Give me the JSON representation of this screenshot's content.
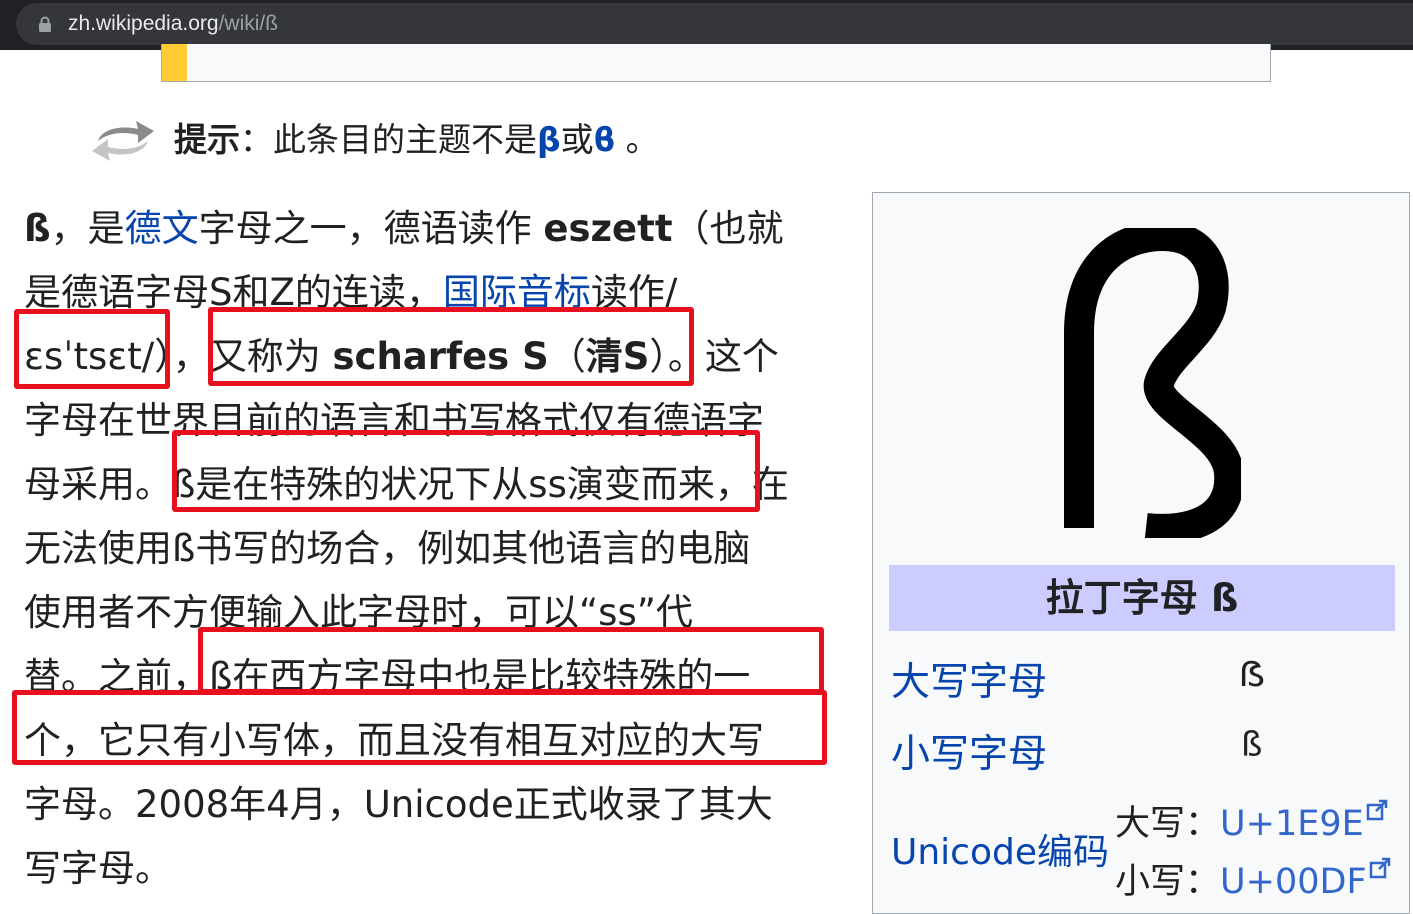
{
  "browser": {
    "url_host": "zh.wikipedia.org",
    "url_path": "/wiki/ß"
  },
  "hatnote": {
    "label": "提示",
    "colon": "：此条目的主题不是",
    "link1": "β",
    "or": "或",
    "link2": "ϐ",
    "end": " 。"
  },
  "article": {
    "l1_a": "ß",
    "l1_b": "，是",
    "l1_link": "德文",
    "l1_c": "字母之一，德语读作 ",
    "l1_bold": "eszett",
    "l1_d": "（也就",
    "l2_a": "是德语字母S和Z的连读，",
    "l2_link": "国际音标",
    "l2_b": "读作/",
    "l3_a": "ɛsˈtsɛt/）",
    "l3_b": "，",
    "l3_c": "又称为 ",
    "l3_bold": "scharfes S",
    "l3_d": "（",
    "l3_bold2": "清S",
    "l3_e": "）。这个",
    "l4": "字母在世界目前的语言和书写格式仅有德语字",
    "l5_a": "母采用。",
    "l5_b": "ß是在特殊的状况下从ss演变而来",
    "l5_c": "，在",
    "l6": "无法使用ß书写的场合，例如其他语言的电脑",
    "l7": "使用者不方便输入此字母时，可以“ss”代",
    "l8_a": "替。之前，",
    "l8_b": "ß在西方字母中也是比较特殊的一",
    "l9": "个，它只有小写体，而且没有相互对应的大写",
    "l10": "字母。2008年4月，Unicode正式收录了其大",
    "l11": "写字母。"
  },
  "infobox": {
    "caption": "拉丁字母 ß",
    "upper_label": "大写字母",
    "upper_value": "ẞ",
    "lower_label": "小写字母",
    "lower_value": "ß",
    "unicode_label": "Unicode编码",
    "upper_code_label": "大写：",
    "upper_code": "U+1E9E",
    "lower_code_label": "小写：",
    "lower_code": "U+00DF"
  },
  "colors": {
    "link": "#0645ad",
    "highlight": "#e8101f",
    "caption_bg": "#ccccff"
  },
  "icons": [
    "lock-icon",
    "hatnote-arrows-icon",
    "external-link-icon"
  ]
}
